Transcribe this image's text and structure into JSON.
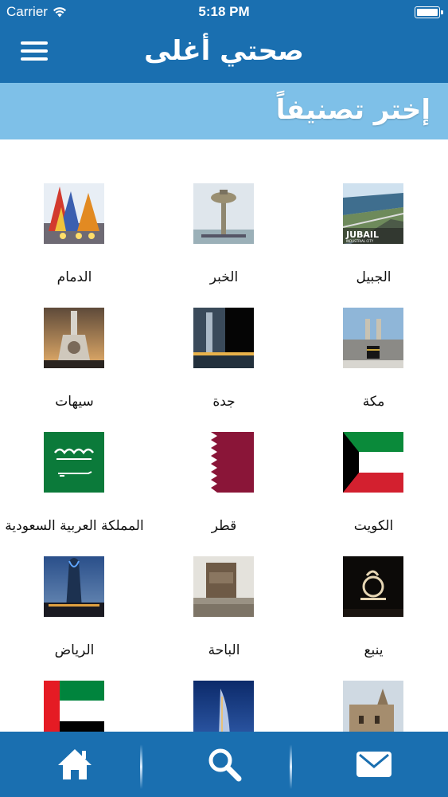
{
  "status_bar": {
    "carrier": "Carrier",
    "time": "5:18 PM"
  },
  "header": {
    "title": "صحتي أغلى"
  },
  "subheader": {
    "label": "إختر تصنيفاً"
  },
  "categories": [
    {
      "label": "الجبيل",
      "icon": "jubail-photo"
    },
    {
      "label": "الخبر",
      "icon": "khobar-water-tower-photo"
    },
    {
      "label": "الدمام",
      "icon": "dammam-sculpture-photo"
    },
    {
      "label": "مكة",
      "icon": "mecca-kaaba-photo"
    },
    {
      "label": "جدة",
      "icon": "jeddah-fountain-photo"
    },
    {
      "label": "سيهات",
      "icon": "saihat-monument-photo"
    },
    {
      "label": "الكويت",
      "icon": "kuwait-flag"
    },
    {
      "label": "قطر",
      "icon": "qatar-flag"
    },
    {
      "label": "المملكة العربية السعودية",
      "icon": "saudi-arabia-flag"
    },
    {
      "label": "ينبع",
      "icon": "yanbu-night-photo"
    },
    {
      "label": "الباحة",
      "icon": "al-baha-tower-photo"
    },
    {
      "label": "الرياض",
      "icon": "riyadh-kingdom-tower-photo"
    },
    {
      "label": "",
      "icon": "mud-houses-photo"
    },
    {
      "label": "",
      "icon": "burj-al-arab-photo"
    },
    {
      "label": "",
      "icon": "uae-flag"
    }
  ],
  "tabbar": {
    "items": [
      {
        "icon": "home-icon"
      },
      {
        "icon": "search-icon"
      },
      {
        "icon": "mail-icon"
      }
    ]
  },
  "colors": {
    "primary": "#1a6fb0",
    "subheader": "#7ec0e8"
  }
}
